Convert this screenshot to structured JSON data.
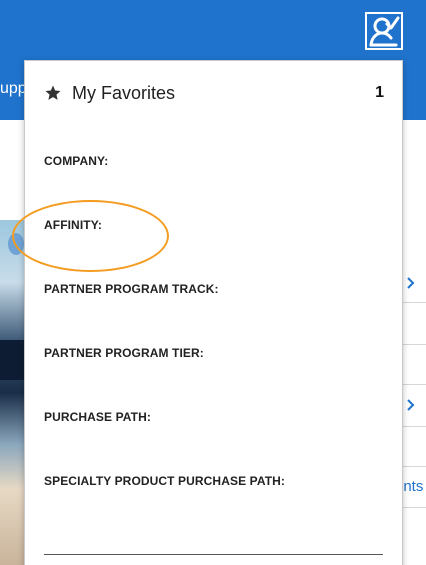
{
  "header": {
    "nav_text_fragment": "upp",
    "user_icon": "user-check-icon"
  },
  "right_column": {
    "link_text_fragment": "ents",
    "chevron_icon": "chevron-right-icon"
  },
  "favorites_panel": {
    "title": "My Favorites",
    "star_icon": "star-icon",
    "count": "1",
    "fields": [
      {
        "label": "COMPANY:"
      },
      {
        "label": "AFFINITY:"
      },
      {
        "label": "PARTNER PROGRAM TRACK:"
      },
      {
        "label": "PARTNER PROGRAM TIER:"
      },
      {
        "label": "PURCHASE PATH:"
      },
      {
        "label": "SPECIALTY PRODUCT PURCHASE PATH:"
      }
    ]
  },
  "colors": {
    "brand_blue": "#1f73cd",
    "annotation_orange": "#f39c1f"
  }
}
